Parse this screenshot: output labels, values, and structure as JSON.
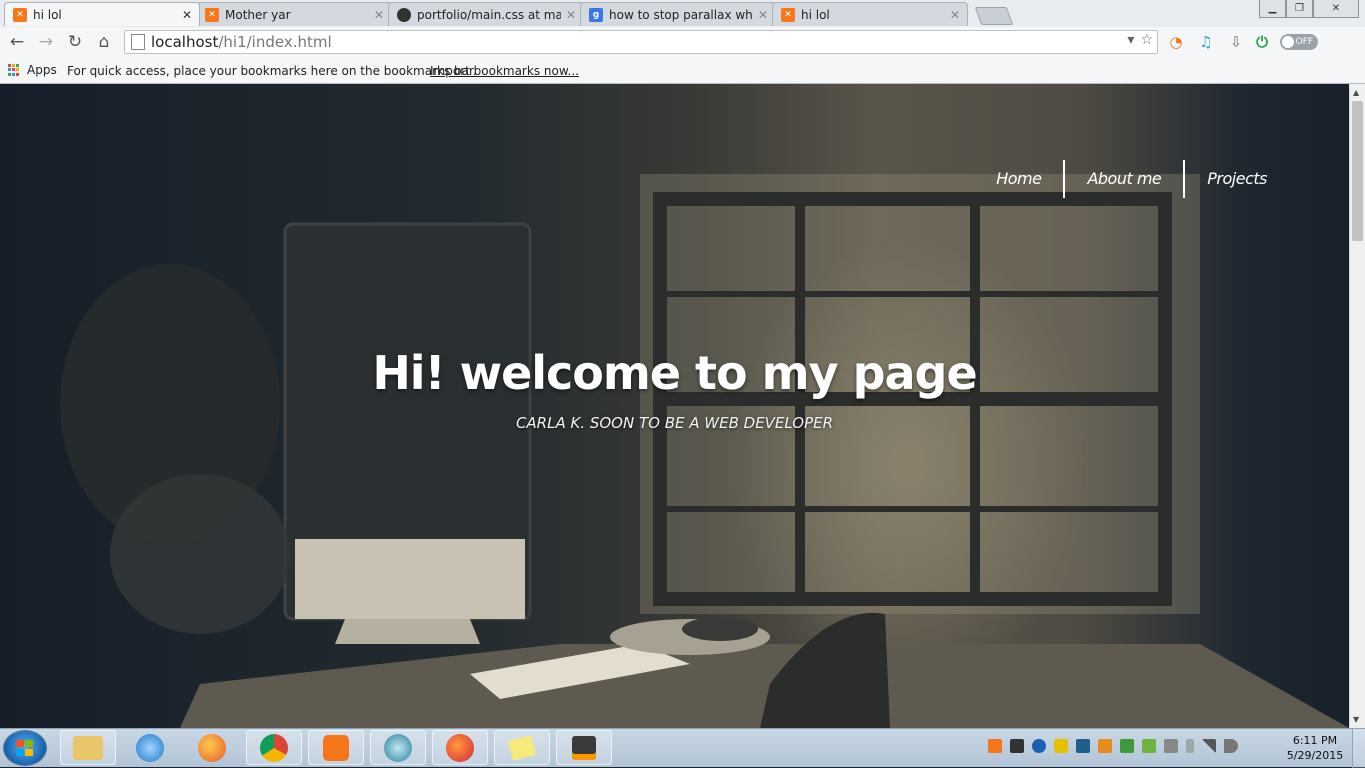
{
  "browser": {
    "tabs": [
      {
        "title": "hi lol",
        "favicon": "xampp-icon",
        "active": true
      },
      {
        "title": "Mother yar",
        "favicon": "xampp-icon",
        "active": false
      },
      {
        "title": "portfolio/main.css at mast",
        "favicon": "github-icon",
        "active": false
      },
      {
        "title": "how to stop parallax when",
        "favicon": "google-icon",
        "active": false
      },
      {
        "title": "hi lol",
        "favicon": "xampp-icon",
        "active": false
      }
    ],
    "url_host": "localhost",
    "url_path": "/hi1/index.html",
    "extension_toggle": "OFF"
  },
  "bookmarks": {
    "apps_label": "Apps",
    "hint": "For quick access, place your bookmarks here on the bookmarks bar.",
    "import_link": "Import bookmarks now..."
  },
  "site": {
    "nav": [
      "Home",
      "About me",
      "Projects"
    ],
    "title": "Hi! welcome to my page",
    "subtitle": "CARLA K. SOON TO BE A WEB DEVELOPER"
  },
  "taskbar": {
    "apps": [
      "file-explorer-icon",
      "internet-explorer-icon",
      "firefox-icon",
      "chrome-icon",
      "xampp-icon",
      "filezilla-icon",
      "firefox-developer-icon",
      "sticky-notes-icon",
      "sublime-text-icon"
    ],
    "time": "6:11 PM",
    "date": "5/29/2015"
  },
  "colors": {
    "accent_xampp": "#f7761a",
    "hero_text": "#ffffff"
  }
}
